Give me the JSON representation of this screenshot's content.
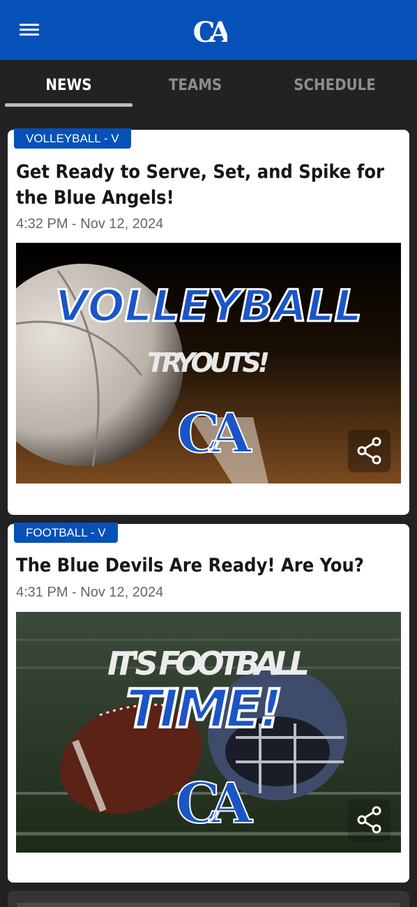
{
  "header": {
    "menu_icon": "hamburger-menu-icon",
    "logo_text": "CA"
  },
  "tabs": [
    {
      "label": "NEWS",
      "active": true
    },
    {
      "label": "TEAMS",
      "active": false
    },
    {
      "label": "SCHEDULE",
      "active": false
    }
  ],
  "colors": {
    "brand_blue": "#0651b8",
    "background": "#222222",
    "card": "#ffffff"
  },
  "news": [
    {
      "category": "VOLLEYBALL - V",
      "title": "Get Ready to Serve, Set, and Spike for the Blue Angels!",
      "timestamp": "4:32 PM - Nov 12, 2024",
      "image_text_1": "VOLLEYBALL",
      "image_text_2": "TRYOUTS!",
      "image_logo": "CA",
      "share_icon": "share-icon"
    },
    {
      "category": "FOOTBALL - V",
      "title": "The Blue Devils Are Ready! Are You?",
      "timestamp": "4:31 PM - Nov 12, 2024",
      "image_text_1": "IT'S FOOTBALL",
      "image_text_2": "TIME!",
      "image_logo": "CA",
      "share_icon": "share-icon"
    }
  ]
}
